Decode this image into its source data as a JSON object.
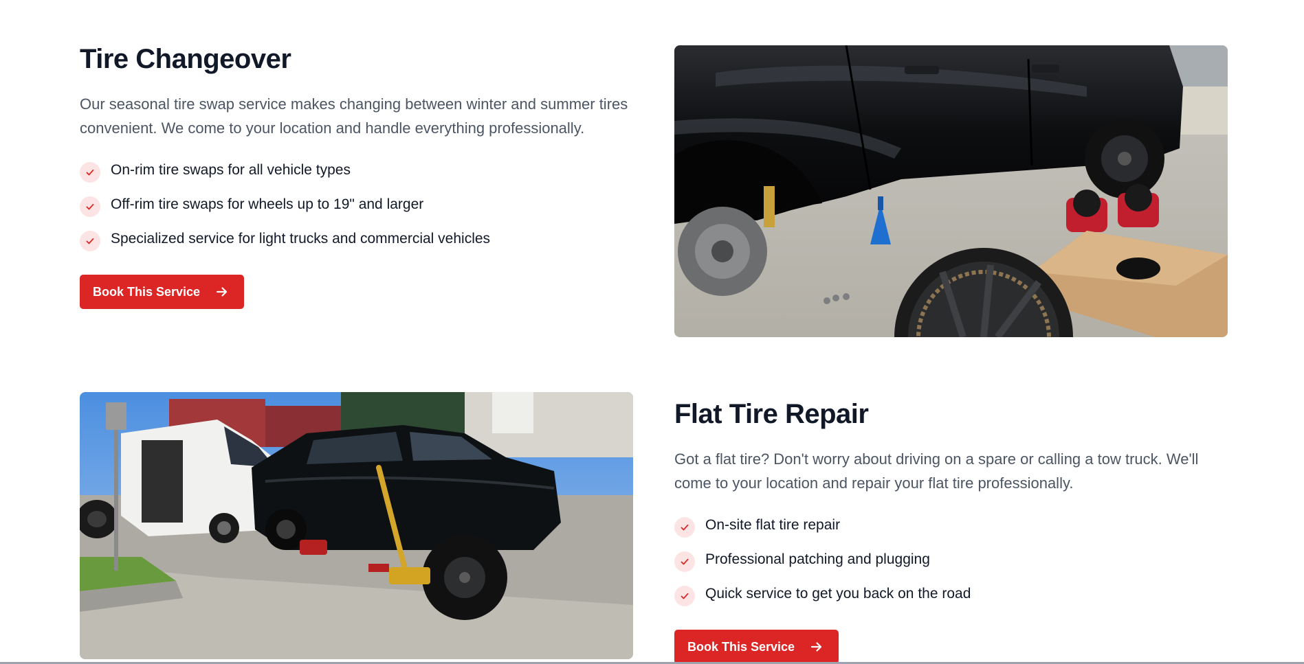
{
  "services": [
    {
      "title": "Tire Changeover",
      "description": "Our seasonal tire swap service makes changing between winter and summer tires convenient. We come to your location and handle everything professionally.",
      "features": [
        "On-rim tire swaps for all vehicle types",
        "Off-rim tire swaps for wheels up to 19\" and larger",
        "Specialized service for light trucks and commercial vehicles"
      ],
      "button_label": "Book This Service",
      "image_icon": "photo-black-pickup-truck-on-jack-stand"
    },
    {
      "title": "Flat Tire Repair",
      "description": "Got a flat tire? Don't worry about driving on a spare or calling a tow truck. We'll come to your location and repair your flat tire professionally.",
      "features": [
        "On-site flat tire repair",
        "Professional patching and plugging",
        "Quick service to get you back on the road"
      ],
      "button_label": "Book This Service",
      "image_icon": "photo-service-van-and-suv-on-jack"
    }
  ],
  "colors": {
    "accent": "#dc2626",
    "check_bg": "#fde4e4",
    "heading": "#111827",
    "body_text": "#4b5563"
  },
  "icons": {
    "feature": "check-icon",
    "button": "arrow-right-icon"
  }
}
